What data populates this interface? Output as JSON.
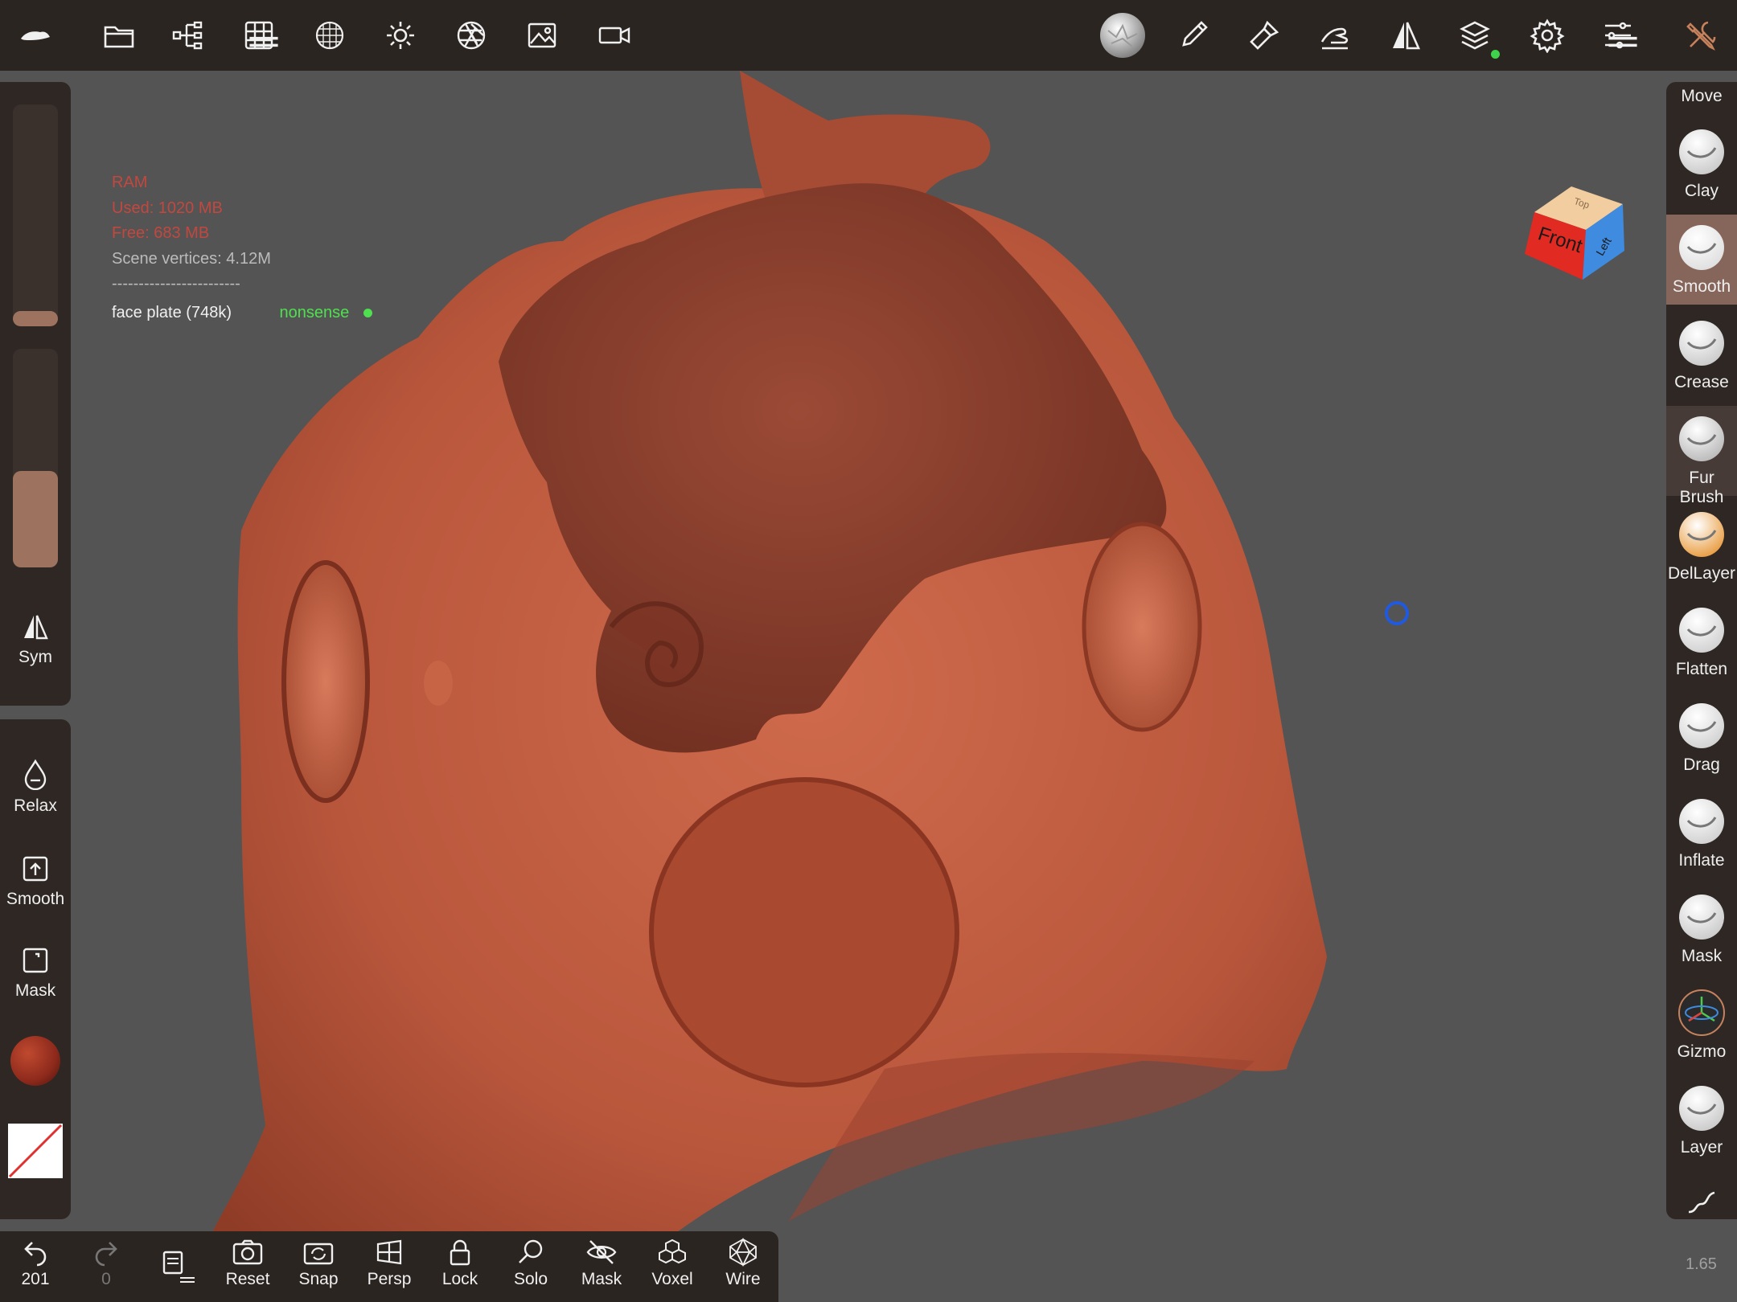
{
  "top_toolbar": {
    "icons": [
      "app-logo-icon",
      "folder-icon",
      "scene-tree-icon",
      "topology-grid-icon",
      "multires-sphere-icon",
      "light-sun-icon",
      "aperture-icon",
      "image-icon",
      "camera-record-icon",
      "current-brush-icon",
      "brush-pen-icon",
      "paint-brush-icon",
      "hand-stroke-icon",
      "symmetry-icon",
      "layers-icon",
      "settings-gear-icon",
      "sliders-icon",
      "tools-icon"
    ],
    "layers_status_color": "#3ed34a"
  },
  "info": {
    "ram_label": "RAM",
    "used": "Used: 1020 MB",
    "free": "Free: 683 MB",
    "vertices": "Scene vertices: 4.12M",
    "separator": "------------------------",
    "mesh_name": "face plate (748k)",
    "mesh_tag": "nonsense",
    "warning_color": "#c2483f",
    "tag_color": "#4fe04f"
  },
  "left_panel": {
    "radius_fill": 0.07,
    "intensity_fill": 0.44,
    "sym_label": "Sym",
    "relax_label": "Relax",
    "smooth_label": "Smooth",
    "mask_label": "Mask",
    "material_color": "#8e2a1c",
    "accent_color": "#9d7360"
  },
  "right_panel": {
    "move_label": "Move",
    "brushes": [
      {
        "label": "Clay",
        "state": "normal"
      },
      {
        "label": "Smooth",
        "state": "selected"
      },
      {
        "label": "Crease",
        "state": "normal"
      },
      {
        "label": "Fur Brush",
        "state": "hover"
      },
      {
        "label": "DelLayer",
        "state": "normal"
      },
      {
        "label": "Flatten",
        "state": "normal"
      },
      {
        "label": "Drag",
        "state": "normal"
      },
      {
        "label": "Inflate",
        "state": "normal"
      },
      {
        "label": "Mask",
        "state": "normal"
      },
      {
        "label": "Gizmo",
        "state": "normal"
      },
      {
        "label": "Layer",
        "state": "normal"
      }
    ],
    "zoom": "1.65"
  },
  "bottom_toolbar": {
    "undo_count": "201",
    "redo_count": "0",
    "reset": "Reset",
    "snap": "Snap",
    "persp": "Persp",
    "lock": "Lock",
    "solo": "Solo",
    "mask": "Mask",
    "voxel": "Voxel",
    "wire": "Wire"
  },
  "nav_cube": {
    "front": "Front",
    "left": "Left",
    "top": "Top",
    "front_color": "#e02a22",
    "left_color": "#3f8be0",
    "top_color": "#f2cda0"
  }
}
